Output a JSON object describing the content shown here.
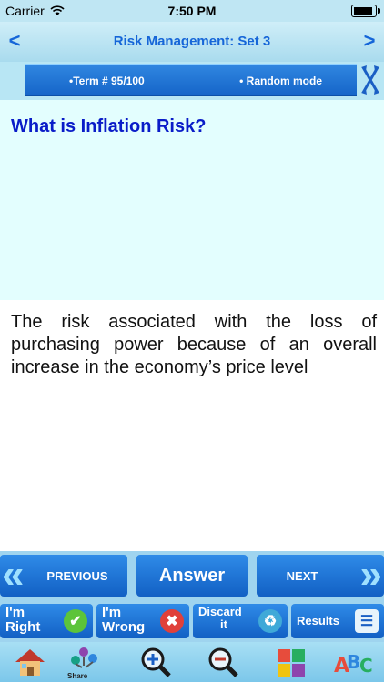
{
  "status": {
    "carrier": "Carrier",
    "time": "7:50 PM",
    "battery_level": 0.9
  },
  "nav": {
    "title": "Risk Management: Set 3",
    "back_glyph": "<",
    "forward_glyph": ">"
  },
  "info": {
    "term": "•Term #  95/100",
    "mode": "• Random mode"
  },
  "card": {
    "question": "What is Inflation Risk?",
    "answer": "The risk associated with the loss of purchasing power because of an overall increase in the economy’s price level"
  },
  "controls": {
    "previous": "PREVIOUS",
    "answer": "Answer",
    "next": "NEXT"
  },
  "grading": {
    "right_line1": "I'm",
    "right_line2": "Right",
    "wrong_line1": "I'm",
    "wrong_line2": "Wrong",
    "discard_line1": "Discard",
    "discard_line2": "it",
    "results": "Results"
  },
  "toolbar": {
    "share": "Share"
  },
  "colors": {
    "accent": "#1565d8",
    "button": "#1f77d8",
    "question_bg": "#e3fefe",
    "right": "#5cc43a",
    "wrong": "#e0403a"
  }
}
